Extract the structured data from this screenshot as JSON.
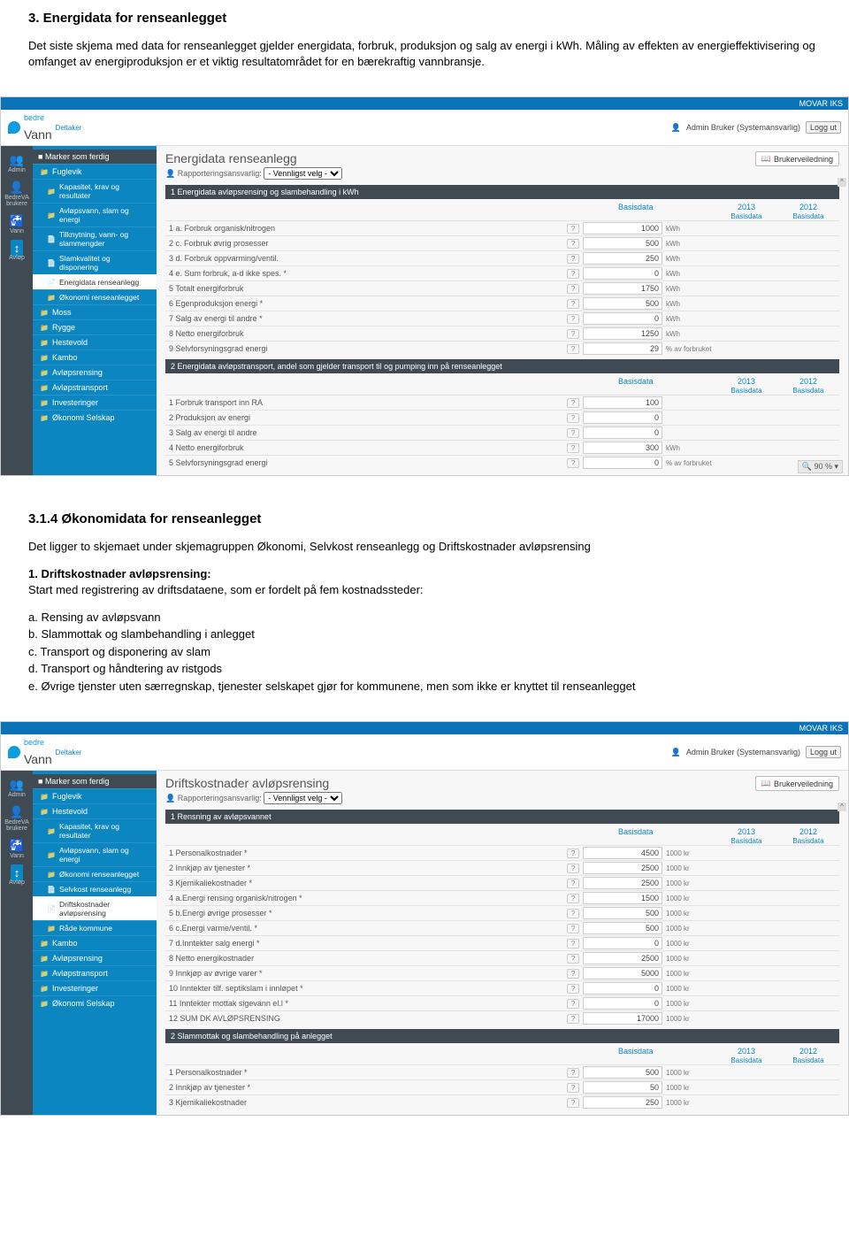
{
  "doc": {
    "h1": "3. Energidata for renseanlegget",
    "p1": "Det siste skjema med data for renseanlegget gjelder energidata, forbruk, produksjon og salg av energi i kWh. Måling av effekten av energieffektivisering og omfanget av energiproduksjon er et viktig resultatområdet for en bærekraftig vannbransje.",
    "h2": "3.1.4   Økonomidata for renseanlegget",
    "p2": "Det ligger to skjemaet under skjemagruppen Økonomi, Selvkost renseanlegg og Driftskostnader avløpsrensing",
    "p3a": "1. Driftskostnader avløpsrensing:",
    "p3b": "Start med registrering av driftsdataene, som er fordelt på fem kostnadssteder:",
    "list": {
      "a": "a. Rensing av avløpsvann",
      "b": "b. Slammottak og slambehandling  i anlegget",
      "c": "c. Transport og disponering av slam",
      "d": "d. Transport og håndtering av ristgods",
      "e": "e. Øvrige tjenster uten særregnskap, tjenester selskapet gjør for kommunene, men som ikke er knyttet til renseanlegget"
    }
  },
  "ui": {
    "topbar": "MOVAR IKS",
    "brand_small": "bedre",
    "brand_main": "Vann",
    "brand_badge": "Deltaker",
    "user_label": "Admin Bruker (Systemansvarlig)",
    "logout": "Logg ut",
    "iconcol": {
      "admin": "Admin",
      "brukere": "BedreVA brukere",
      "vann": "Vann",
      "avlop": "Avløp"
    },
    "guide_btn": "Brukerveiledning",
    "rap_label": "Rapporteringsansvarlig:",
    "rap_value": "- Vennligst velg -",
    "years": {
      "y1": "2013",
      "y2": "2012",
      "base": "Basisdata"
    },
    "zoom": "90 %"
  },
  "shot1": {
    "title": "Energidata renseanlegg",
    "nav_top": "Marker som ferdig",
    "nav": [
      {
        "t": "Fuglevik",
        "cls": "folder"
      },
      {
        "t": "Kapasitet, krav og resultater",
        "cls": "folder sub"
      },
      {
        "t": "Avløpsvann, slam og energi",
        "cls": "folder sub"
      },
      {
        "t": "Tilknytning, vann- og slammengder",
        "cls": "file sub"
      },
      {
        "t": "Slamkvalitet og disponering",
        "cls": "file sub"
      },
      {
        "t": "Energidata renseanlegg",
        "cls": "file sub sel"
      },
      {
        "t": "Økonomi renseanlegget",
        "cls": "folder sub"
      },
      {
        "t": "Moss",
        "cls": "folder"
      },
      {
        "t": "Rygge",
        "cls": "folder"
      },
      {
        "t": "Hestevold",
        "cls": "folder"
      },
      {
        "t": "Kambo",
        "cls": "folder"
      },
      {
        "t": "Avløpsrensing",
        "cls": "folder"
      },
      {
        "t": "Avløpstransport",
        "cls": "folder"
      },
      {
        "t": "Investeringer",
        "cls": "folder"
      },
      {
        "t": "Økonomi Selskap",
        "cls": "folder"
      }
    ],
    "sect1": "1  Energidata avløpsrensing og slambehandling i kWh",
    "rows1": [
      {
        "l": "1 a. Forbruk organisk/nitrogen",
        "v": "1000",
        "u": "kWh"
      },
      {
        "l": "2 c. Forbruk øvrig prosesser",
        "v": "500",
        "u": "kWh"
      },
      {
        "l": "3 d. Forbruk oppvarming/ventil.",
        "v": "250",
        "u": "kWh"
      },
      {
        "l": "4 e. Sum forbruk, a-d ikke spes. *",
        "v": "0",
        "u": "kWh"
      },
      {
        "l": "5 Totalt energiforbruk",
        "v": "1750",
        "u": "kWh"
      },
      {
        "l": "6 Egenproduksjon energi *",
        "v": "500",
        "u": "kWh"
      },
      {
        "l": "7 Salg av energi til andre *",
        "v": "0",
        "u": "kWh"
      },
      {
        "l": "8 Netto energiforbruk",
        "v": "1250",
        "u": "kWh"
      },
      {
        "l": "9 Selvforsyningsgrad energi",
        "v": "29",
        "u": "% av forbruket"
      }
    ],
    "sect2": "2  Energidata avløpstransport, andel som gjelder transport til og pumping inn på renseanlegget",
    "rows2": [
      {
        "l": "1 Forbruk transport inn RA",
        "v": "100",
        "u": ""
      },
      {
        "l": "2 Produksjon av energi",
        "v": "0",
        "u": ""
      },
      {
        "l": "3 Salg av energi til andre",
        "v": "0",
        "u": ""
      },
      {
        "l": "4 Netto energiforbruk",
        "v": "300",
        "u": "kWh"
      },
      {
        "l": "5 Selvforsyningsgrad energi",
        "v": "0",
        "u": "% av forbruket"
      }
    ]
  },
  "shot2": {
    "title": "Driftskostnader avløpsrensing",
    "nav_top": "Marker som ferdig",
    "nav": [
      {
        "t": "Fuglevik",
        "cls": "folder"
      },
      {
        "t": "Hestevold",
        "cls": "folder"
      },
      {
        "t": "Kapasitet, krav og resultater",
        "cls": "folder sub"
      },
      {
        "t": "Avløpsvann, slam og energi",
        "cls": "folder sub"
      },
      {
        "t": "Økonomi renseanlegget",
        "cls": "folder sub"
      },
      {
        "t": "Selvkost renseanlegg",
        "cls": "file sub"
      },
      {
        "t": "Driftskostnader avløpsrensing",
        "cls": "file sub sel"
      },
      {
        "t": "Råde kommune",
        "cls": "folder sub"
      },
      {
        "t": "Kambo",
        "cls": "folder"
      },
      {
        "t": "Avløpsrensing",
        "cls": "folder"
      },
      {
        "t": "Avløpstransport",
        "cls": "folder"
      },
      {
        "t": "Investeringer",
        "cls": "folder"
      },
      {
        "t": "Økonomi Selskap",
        "cls": "folder"
      }
    ],
    "sect1": "1  Rensning av avløpsvannet",
    "rows1": [
      {
        "l": "1 Personalkostnader *",
        "v": "4500",
        "u": "1000 kr"
      },
      {
        "l": "2 Innkjøp av tjenester *",
        "v": "2500",
        "u": "1000 kr"
      },
      {
        "l": "3 Kjemikaliekostnader *",
        "v": "2500",
        "u": "1000 kr"
      },
      {
        "l": "4 a.Energi rensing organisk/nitrogen *",
        "v": "1500",
        "u": "1000 kr"
      },
      {
        "l": "5 b.Energi øvrige prosesser *",
        "v": "500",
        "u": "1000 kr"
      },
      {
        "l": "6 c.Energi varme/ventil. *",
        "v": "500",
        "u": "1000 kr"
      },
      {
        "l": "7 d.Inntekter salg energi *",
        "v": "0",
        "u": "1000 kr"
      },
      {
        "l": "8 Netto energikostnader",
        "v": "2500",
        "u": "1000 kr"
      },
      {
        "l": "9 Innkjøp av øvrige varer *",
        "v": "5000",
        "u": "1000 kr"
      },
      {
        "l": "10 Inntekter tilf. septikslam i innløpet *",
        "v": "0",
        "u": "1000 kr"
      },
      {
        "l": "11 Inntekter mottak sigevann el.l *",
        "v": "0",
        "u": "1000 kr"
      },
      {
        "l": "12 SUM DK AVLØPSRENSING",
        "v": "17000",
        "u": "1000 kr"
      }
    ],
    "sect2": "2  Slammottak og slambehandling på anlegget",
    "rows2": [
      {
        "l": "1 Personalkostnader *",
        "v": "500",
        "u": "1000 kr"
      },
      {
        "l": "2 Innkjøp av tjenester *",
        "v": "50",
        "u": "1000 kr"
      },
      {
        "l": "3 Kjemikaliekostnader",
        "v": "250",
        "u": "1000 kr"
      }
    ]
  }
}
